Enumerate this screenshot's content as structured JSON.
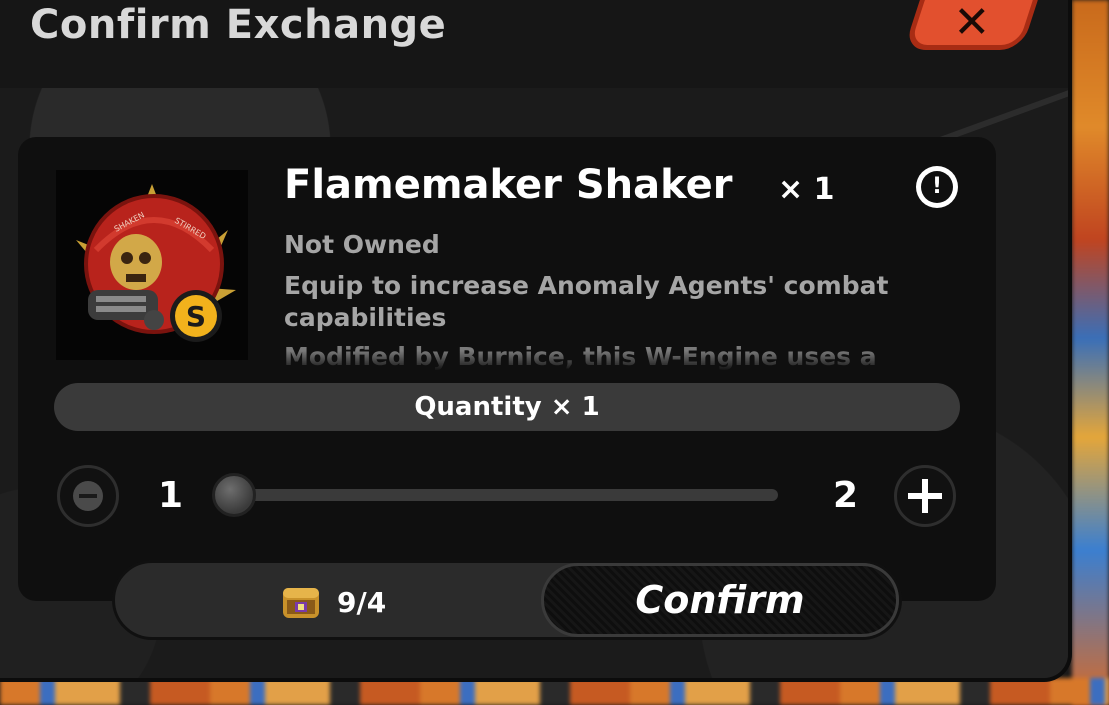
{
  "dialog": {
    "title": "Confirm Exchange",
    "close_icon": "close-icon"
  },
  "item": {
    "name": "Flamemaker Shaker",
    "count": "× 1",
    "rank": "S",
    "status": "Not Owned",
    "description": "Equip to increase Anomaly Agents' combat capabilities",
    "lore": "Modified by Burnice, this W-Engine uses a",
    "info_icon": "info-icon",
    "art_text": [
      "SHAKEN",
      "STIRRED"
    ]
  },
  "quantity": {
    "label": "Quantity × 1",
    "min": "1",
    "max": "2",
    "value": 1,
    "minus_icon": "minus-icon",
    "plus_icon": "plus-icon"
  },
  "footer": {
    "cost": "9/4",
    "cost_icon": "currency-chest-icon",
    "confirm_label": "Confirm"
  },
  "colors": {
    "close_button": "#e2502e",
    "rank_badge": "#f2b21c"
  }
}
